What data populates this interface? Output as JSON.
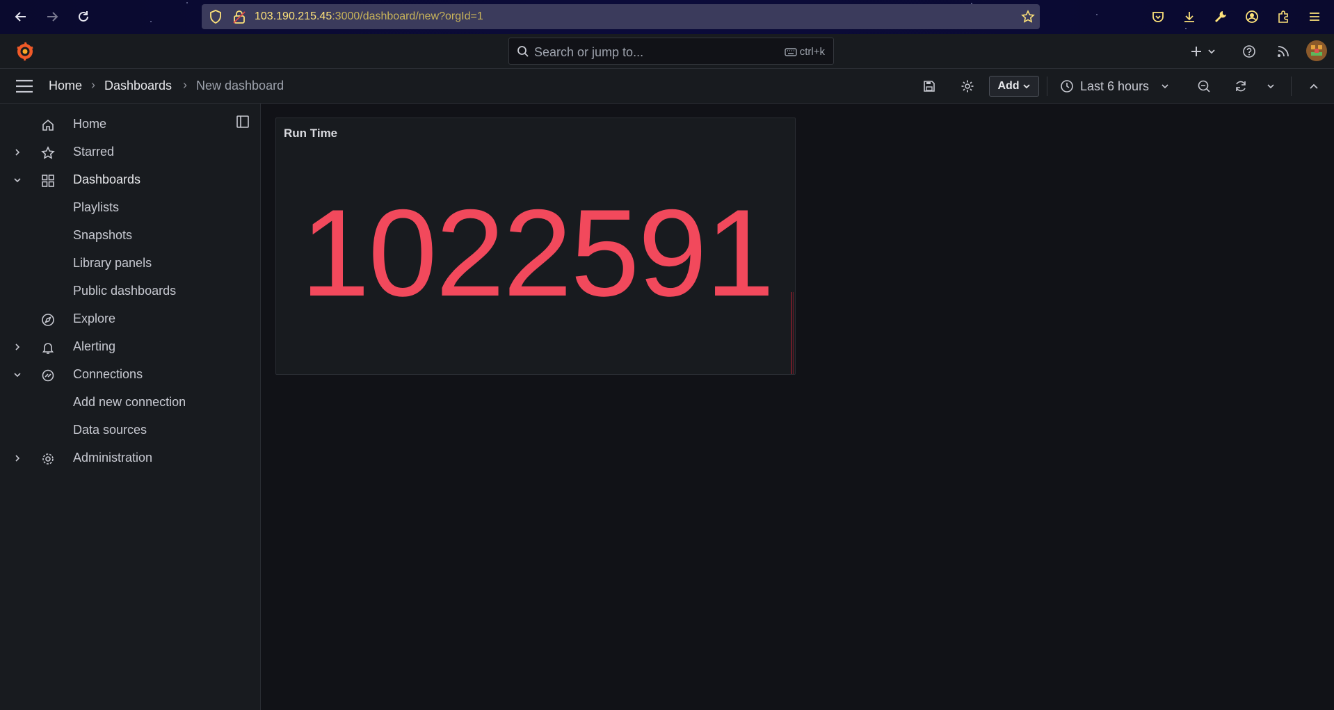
{
  "browser": {
    "url_host": "103.190.215.45",
    "url_path": ":3000/dashboard/new?orgId=1"
  },
  "topbar": {
    "search_placeholder": "Search or jump to...",
    "search_shortcut": "ctrl+k"
  },
  "breadcrumb": {
    "items": [
      "Home",
      "Dashboards",
      "New dashboard"
    ]
  },
  "toolbar": {
    "add_label": "Add",
    "time_range": "Last 6 hours"
  },
  "sidebar": {
    "items": [
      {
        "label": "Home",
        "icon": "home-icon"
      },
      {
        "label": "Starred",
        "icon": "star-icon"
      },
      {
        "label": "Dashboards",
        "icon": "apps-icon"
      },
      {
        "label": "Playlists"
      },
      {
        "label": "Snapshots"
      },
      {
        "label": "Library panels"
      },
      {
        "label": "Public dashboards"
      },
      {
        "label": "Explore",
        "icon": "compass-icon"
      },
      {
        "label": "Alerting",
        "icon": "bell-icon"
      },
      {
        "label": "Connections",
        "icon": "connections-icon"
      },
      {
        "label": "Add new connection"
      },
      {
        "label": "Data sources"
      },
      {
        "label": "Administration",
        "icon": "cog-icon"
      }
    ]
  },
  "panel": {
    "title": "Run Time",
    "value": "1022591"
  },
  "colors": {
    "value_color": "#f2495c",
    "background": "#111217",
    "panel_bg": "#181b1f",
    "url_color": "#fde27a"
  }
}
